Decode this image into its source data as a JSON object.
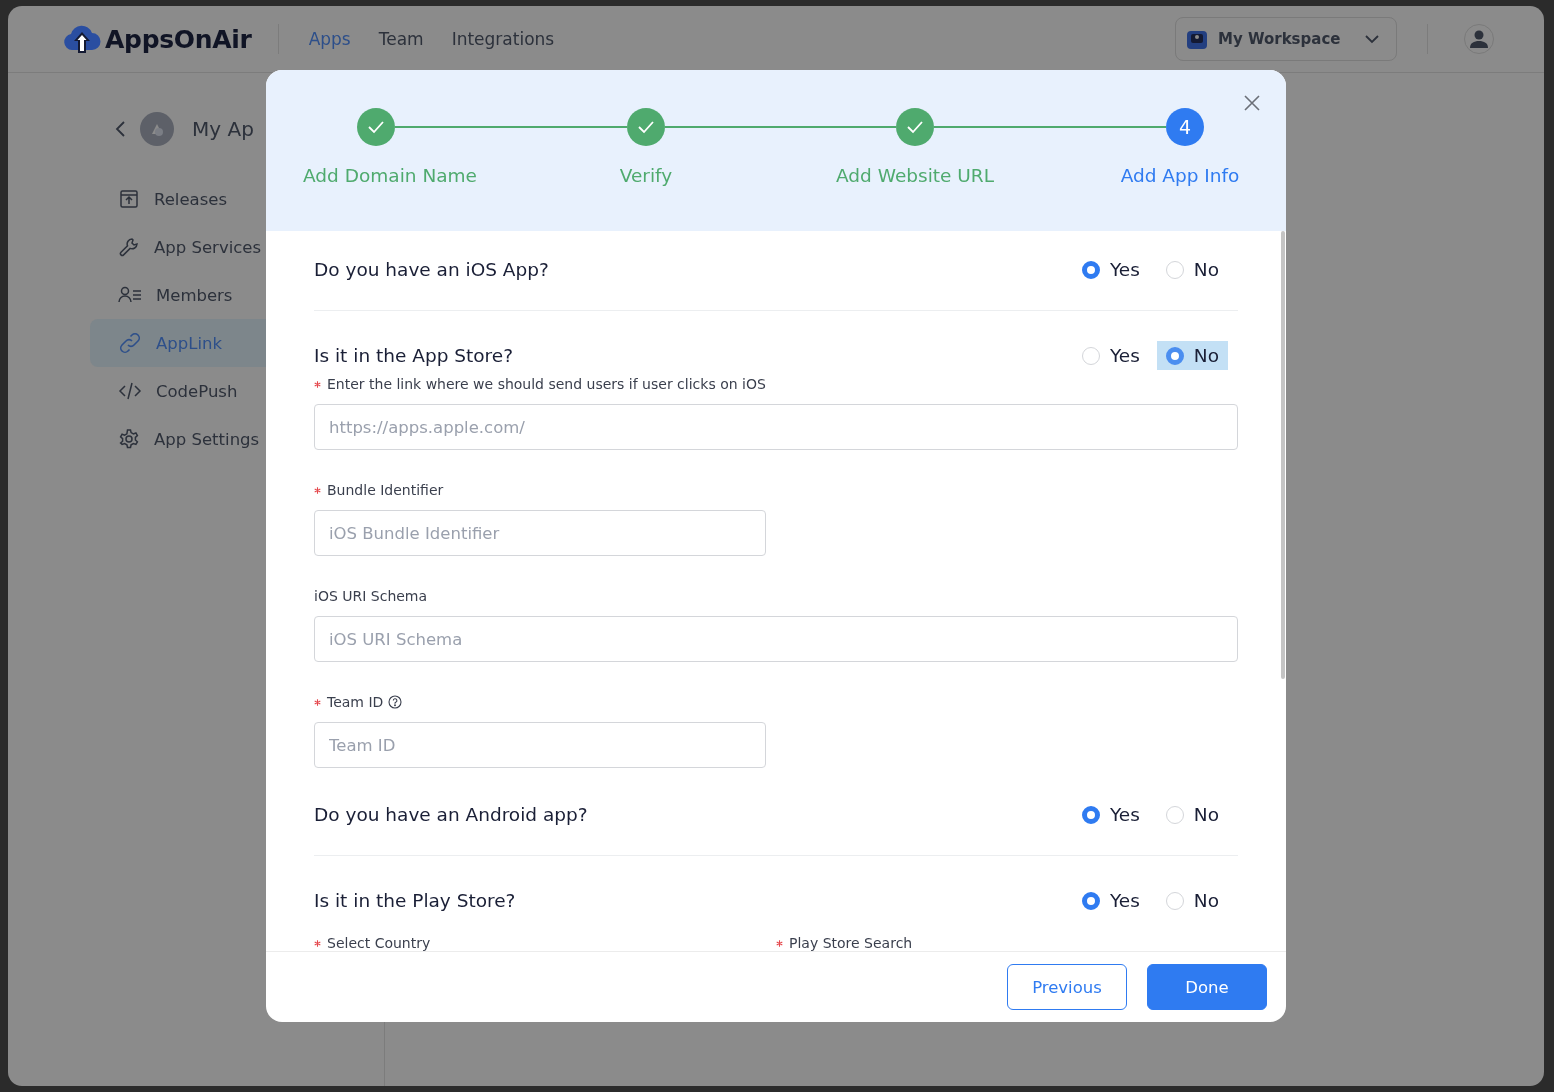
{
  "header": {
    "brand": "AppsOnAir",
    "nav": [
      {
        "label": "Apps",
        "selected": true
      },
      {
        "label": "Team",
        "selected": false
      },
      {
        "label": "Integrations",
        "selected": false
      }
    ],
    "workspace": "My Workspace"
  },
  "sidebar": {
    "app_name": "My Ap",
    "items": [
      {
        "label": "Releases",
        "kind": "releases",
        "selected": false
      },
      {
        "label": "App Services",
        "kind": "services",
        "selected": false
      },
      {
        "label": "Members",
        "kind": "members",
        "selected": false
      },
      {
        "label": "AppLink",
        "kind": "link",
        "selected": true
      },
      {
        "label": "CodePush",
        "kind": "code",
        "selected": false
      },
      {
        "label": "App Settings",
        "kind": "settings",
        "selected": false
      }
    ]
  },
  "modal": {
    "steps": [
      {
        "label": "Add Domain Name",
        "completed": true
      },
      {
        "label": "Verify",
        "completed": true
      },
      {
        "label": "Add Website URL",
        "completed": true
      },
      {
        "label": "Add App Info",
        "completed": false,
        "number": "4"
      }
    ],
    "form": [
      {
        "kind": "question",
        "text": "Do you have an iOS App?",
        "divider": true,
        "options": [
          {
            "label": "Yes",
            "selected": true,
            "highlighted": false
          },
          {
            "label": "No",
            "selected": false,
            "highlighted": false
          }
        ]
      },
      {
        "kind": "question",
        "text": "Is it in the App Store?",
        "divider": false,
        "options": [
          {
            "label": "Yes",
            "selected": false,
            "highlighted": false
          },
          {
            "label": "No",
            "selected": true,
            "highlighted": true
          }
        ]
      },
      {
        "kind": "longfield",
        "label": "Enter the link where we should send users if user clicks on iOS",
        "required": true,
        "help": false,
        "placeholder": "https://apps.apple.com/"
      },
      {
        "kind": "shortfield",
        "label": "Bundle Identifier",
        "required": true,
        "help": false,
        "placeholder": "iOS Bundle Identifier"
      },
      {
        "kind": "longfield",
        "label": "iOS URI Schema",
        "required": false,
        "help": false,
        "placeholder": "iOS URI Schema"
      },
      {
        "kind": "shortfield",
        "label": "Team ID",
        "required": true,
        "help": true,
        "placeholder": "Team ID"
      },
      {
        "kind": "question",
        "text": "Do you have an Android app?",
        "divider": true,
        "options": [
          {
            "label": "Yes",
            "selected": true,
            "highlighted": false
          },
          {
            "label": "No",
            "selected": false,
            "highlighted": false
          }
        ]
      },
      {
        "kind": "question",
        "text": "Is it in the Play Store?",
        "divider": false,
        "options": [
          {
            "label": "Yes",
            "selected": true,
            "highlighted": false
          },
          {
            "label": "No",
            "selected": false,
            "highlighted": false
          }
        ]
      },
      {
        "kind": "labels",
        "labels": [
          {
            "label": "Select Country",
            "required": true
          },
          {
            "label": "Play Store Search",
            "required": true
          }
        ]
      }
    ],
    "buttons": [
      {
        "label": "Previous",
        "kind": "secondary"
      },
      {
        "label": "Done",
        "kind": "primary"
      }
    ]
  }
}
